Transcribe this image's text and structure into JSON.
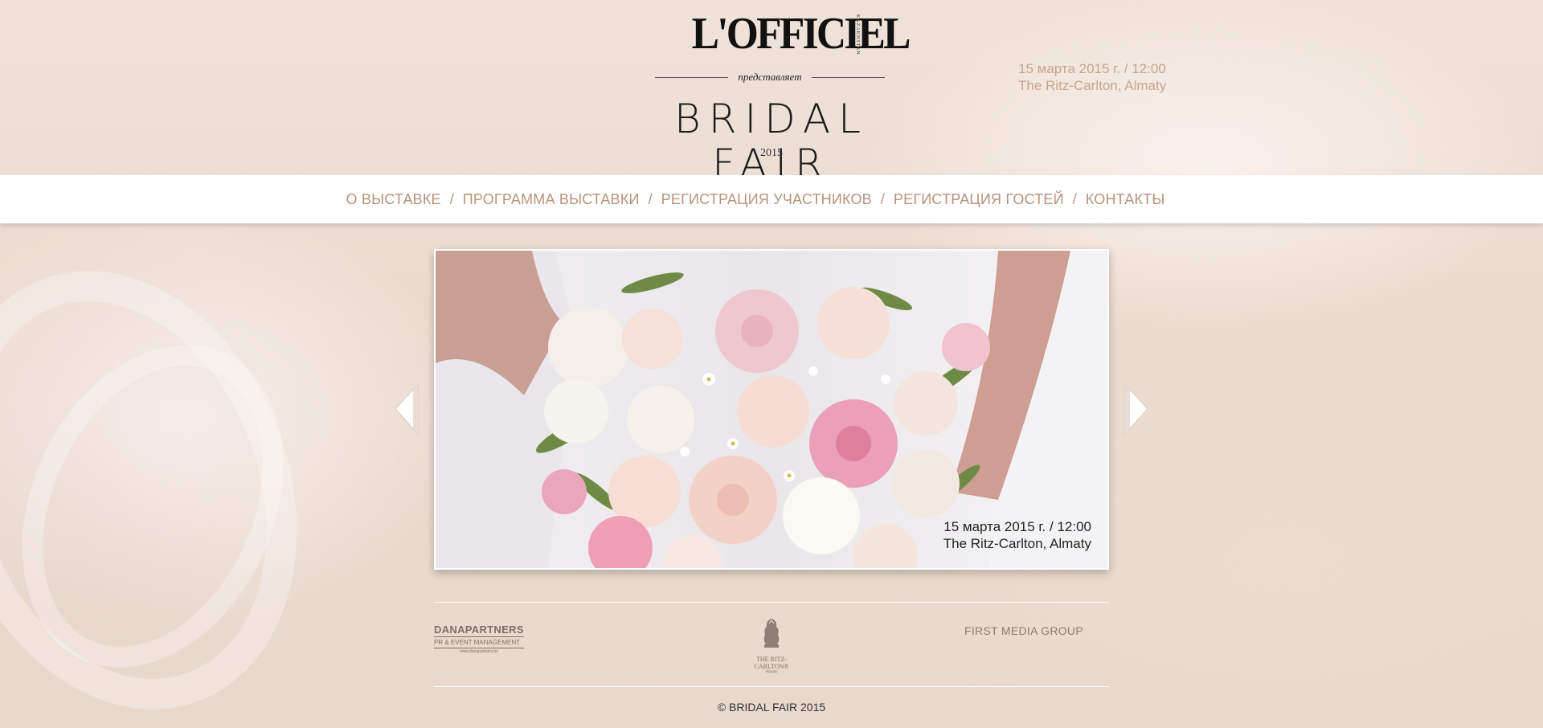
{
  "header": {
    "logo": "L'OFFICIEL",
    "logo_sub": "KAZAKHSTAN",
    "presents": "представляет",
    "title": "BRIDAL FAIR",
    "year": "2015",
    "date_line": "15 марта 2015 г. / 12:00",
    "venue_line": "The Ritz-Carlton, Almaty"
  },
  "nav": {
    "items": [
      {
        "label": "О ВЫСТАВКЕ"
      },
      {
        "label": "ПРОГРАММА ВЫСТАВКИ"
      },
      {
        "label": "РЕГИСТРАЦИЯ УЧАСТНИКОВ"
      },
      {
        "label": "РЕГИСТРАЦИЯ ГОСТЕЙ"
      },
      {
        "label": "КОНТАКТЫ"
      }
    ],
    "separator": "/"
  },
  "slider": {
    "caption_date": "15 марта 2015 г. / 12:00",
    "caption_venue": "The Ritz-Carlton, Almaty",
    "prev_icon": "chevron-left-icon",
    "next_icon": "chevron-right-icon"
  },
  "sponsors": {
    "danapartners": {
      "name": "DANAPARTNERS",
      "tagline": "PR & EVENT MANAGEMENT",
      "url": "www.danapartners.kz"
    },
    "ritz": {
      "name": "THE RITZ-CARLTON®",
      "sub": "Almaty"
    },
    "fmg": {
      "name": "FIRST MEDIA GROUP"
    }
  },
  "footer": {
    "copyright": "© BRIDAL FAIR 2015"
  },
  "colors": {
    "accent": "#b8927c",
    "header_date": "#c9a48c",
    "background": "#ecdcd0"
  }
}
